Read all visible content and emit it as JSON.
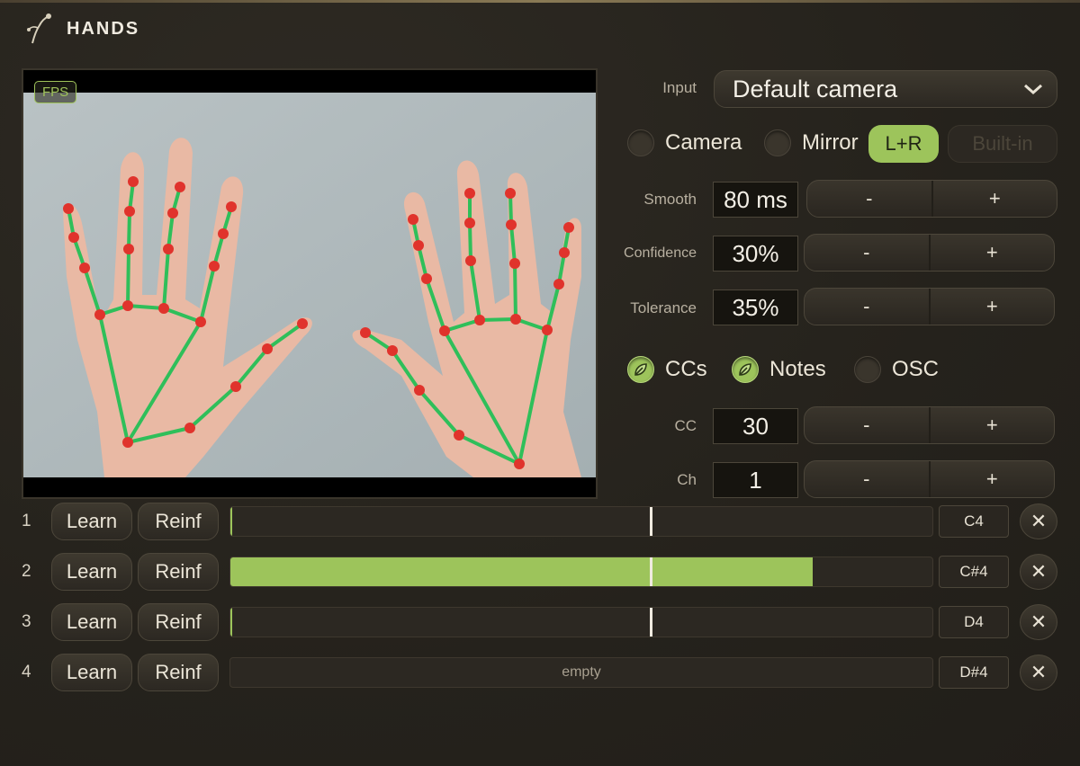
{
  "app": {
    "title": "HANDS"
  },
  "video": {
    "fps_badge": "FPS"
  },
  "input": {
    "label": "Input",
    "value": "Default camera"
  },
  "toggles": {
    "camera": {
      "label": "Camera",
      "on": false
    },
    "mirror": {
      "label": "Mirror",
      "on": false
    },
    "lr": {
      "label": "L+R",
      "on": true
    },
    "builtin": {
      "label": "Built-in",
      "on": false
    }
  },
  "params": [
    {
      "label": "Smooth",
      "value": "80 ms"
    },
    {
      "label": "Confidence",
      "value": "30%"
    },
    {
      "label": "Tolerance",
      "value": "35%"
    }
  ],
  "outputs": {
    "ccs": {
      "label": "CCs",
      "on": true
    },
    "notes": {
      "label": "Notes",
      "on": true
    },
    "osc": {
      "label": "OSC",
      "on": false
    }
  },
  "midi": [
    {
      "label": "CC",
      "value": "30"
    },
    {
      "label": "Ch",
      "value": "1"
    }
  ],
  "stepper": {
    "minus": "-",
    "plus": "+"
  },
  "slots": [
    {
      "num": "1",
      "learn": "Learn",
      "reinf": "Reinf",
      "level": 0.003,
      "note": "C4",
      "empty_text": ""
    },
    {
      "num": "2",
      "learn": "Learn",
      "reinf": "Reinf",
      "level": 0.83,
      "note": "C#4",
      "empty_text": ""
    },
    {
      "num": "3",
      "learn": "Learn",
      "reinf": "Reinf",
      "level": 0.003,
      "note": "D4",
      "empty_text": ""
    },
    {
      "num": "4",
      "learn": "Learn",
      "reinf": "Reinf",
      "level": 0,
      "note": "D#4",
      "empty_text": "empty"
    }
  ],
  "remove_glyph": "✕",
  "colors": {
    "accent": "#9dc45b",
    "skeleton": "#2fbf5a",
    "landmark": "#e0332c"
  }
}
